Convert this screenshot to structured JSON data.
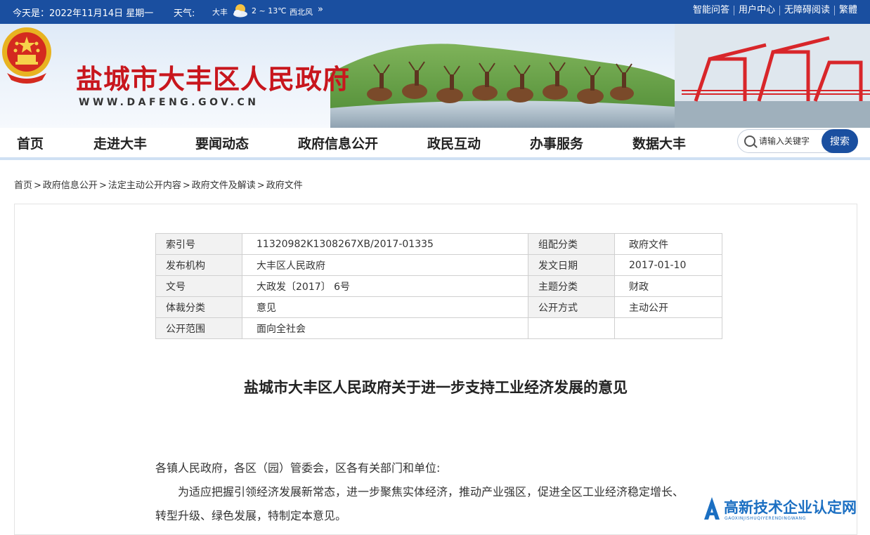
{
  "topbar": {
    "date": "今天是：2022年11月14日 星期一",
    "weather_label": "天气:",
    "city": "大丰",
    "temp": "2 ~ 13℃",
    "wind": "西北风",
    "more": "»",
    "links": [
      "智能问答",
      "用户中心",
      "无障碍阅读",
      "繁體"
    ]
  },
  "site": {
    "title": "盐城市大丰区人民政府",
    "url": "WWW.DAFENG.GOV.CN"
  },
  "nav": {
    "items": [
      "首页",
      "走进大丰",
      "要闻动态",
      "政府信息公开",
      "政民互动",
      "办事服务",
      "数据大丰"
    ],
    "search_placeholder": "请输入关键字",
    "search_button": "搜索"
  },
  "breadcrumb": [
    "首页",
    "政府信息公开",
    "法定主动公开内容",
    "政府文件及解读",
    "政府文件"
  ],
  "breadcrumb_sep": ">",
  "meta": {
    "rows": [
      {
        "k1": "索引号",
        "v1": "11320982K1308267XB/2017-01335",
        "k2": "组配分类",
        "v2": "政府文件"
      },
      {
        "k1": "发布机构",
        "v1": "大丰区人民政府",
        "k2": "发文日期",
        "v2": "2017-01-10"
      },
      {
        "k1": "文号",
        "v1": "大政发〔2017〕 6号",
        "k2": "主题分类",
        "v2": "财政"
      },
      {
        "k1": "体裁分类",
        "v1": "意见",
        "k2": "公开方式",
        "v2": "主动公开"
      },
      {
        "k1": "公开范围",
        "v1": "面向全社会"
      }
    ]
  },
  "document": {
    "title": "盐城市大丰区人民政府关于进一步支持工业经济发展的意见",
    "salutation": "各镇人民政府，各区（园）管委会，区各有关部门和单位:",
    "para1_line1": "为适应把握引领经济发展新常态，进一步聚焦实体经济，推动产业强区，促进全区工业经济稳定增长、",
    "para1_line2": "转型升级、绿色发展，特制定本意见。"
  },
  "watermark": {
    "title": "高新技术企业认定网",
    "subtitle": "GAOXINJISHUQIYERENDINGWANG"
  },
  "colors": {
    "topbar_bg": "#1a4fa0",
    "site_title": "#c8161d",
    "search_button": "#1a4fa0",
    "watermark": "#1b6fc2"
  }
}
